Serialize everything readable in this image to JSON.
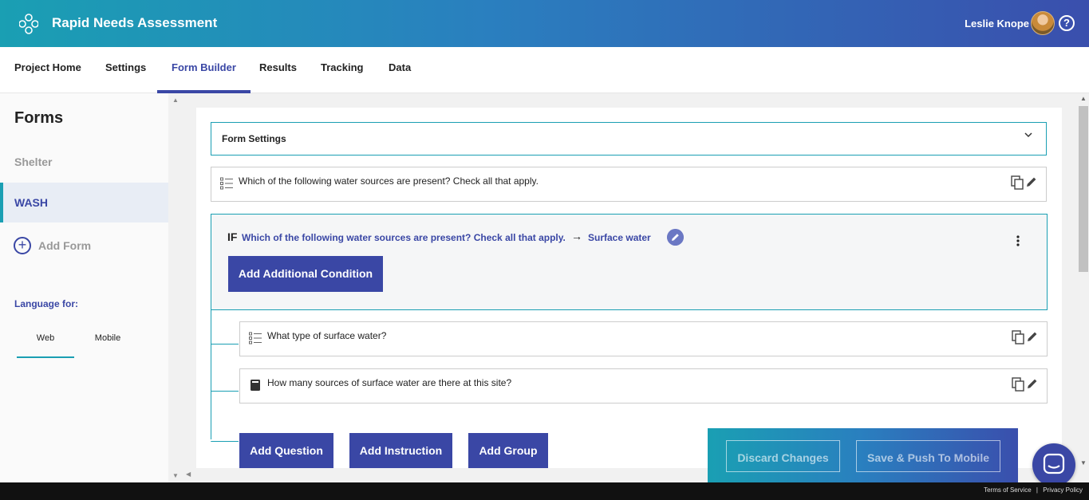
{
  "header": {
    "app_title": "Rapid Needs Assessment",
    "user_name": "Leslie Knope",
    "help_symbol": "?"
  },
  "nav": {
    "tabs": [
      {
        "label": "Project Home"
      },
      {
        "label": "Settings"
      },
      {
        "label": "Form Builder",
        "active": true
      },
      {
        "label": "Results"
      },
      {
        "label": "Tracking"
      },
      {
        "label": "Data"
      }
    ]
  },
  "sidebar": {
    "title": "Forms",
    "forms": [
      {
        "label": "Shelter"
      },
      {
        "label": "WASH",
        "active": true
      }
    ],
    "add_form_label": "Add Form",
    "language_label": "Language for:",
    "language_tabs": [
      {
        "label": "Web",
        "active": true
      },
      {
        "label": "Mobile"
      }
    ]
  },
  "builder": {
    "form_settings_label": "Form Settings",
    "question_1": {
      "text": "Which of the following water sources are present? Check all that apply.",
      "icon": "list-icon"
    },
    "condition": {
      "if_label": "IF",
      "question": "Which of the following water sources are present? Check all that apply.",
      "value": "Surface water",
      "add_condition_label": "Add Additional Condition"
    },
    "sub_questions": [
      {
        "text": "What type of surface water?",
        "icon": "list-icon"
      },
      {
        "text": "How many sources of surface water are there at this site?",
        "icon": "number-icon"
      }
    ],
    "add_question_label": "Add Question",
    "add_instruction_label": "Add Instruction",
    "add_group_label": "Add Group"
  },
  "save_bar": {
    "discard_label": "Discard Changes",
    "save_label": "Save & Push To Mobile"
  },
  "footer": {
    "terms_label": "Terms of Service",
    "privacy_label": "Privacy Policy"
  },
  "colors": {
    "accent": "#3a47a5",
    "teal": "#1a9fb3"
  }
}
